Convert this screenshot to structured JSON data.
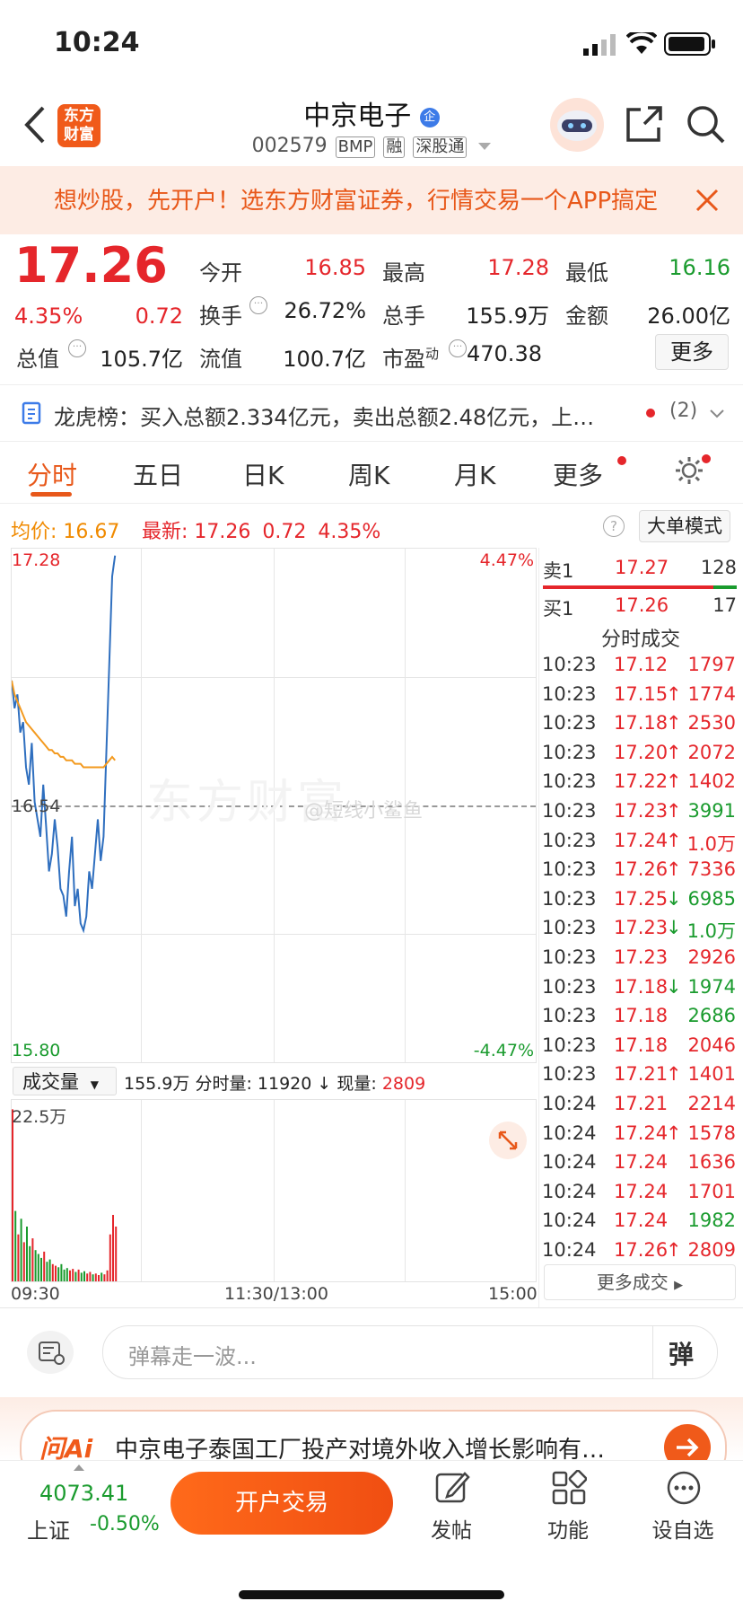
{
  "status_bar": {
    "time": "10:24"
  },
  "header": {
    "stock_name": "中京电子",
    "code": "002579",
    "tags": [
      "BMP",
      "融",
      "深股通"
    ],
    "logo_text_top": "东方",
    "logo_text_bottom": "财富"
  },
  "banner": {
    "text": "想炒股，先开户！选东方财富证券，行情交易一个APP搞定"
  },
  "quote": {
    "price": "17.26",
    "change_pct": "4.35%",
    "change": "0.72",
    "open_label": "今开",
    "open": "16.85",
    "high_label": "最高",
    "high": "17.28",
    "low_label": "最低",
    "low": "16.16",
    "turnover_label": "换手",
    "turnover": "26.72%",
    "volume_label": "总手",
    "volume": "155.9万",
    "amount_label": "金额",
    "amount": "26.00亿",
    "mktcap_label": "总值",
    "mktcap": "105.7亿",
    "float_label": "流值",
    "float": "100.7亿",
    "pe_label": "市盈",
    "pe_sup": "动",
    "pe": "470.38",
    "more_button": "更多"
  },
  "dragon_tiger": {
    "text": "龙虎榜：买入总额2.334亿元，卖出总额2.48亿元，上…",
    "count": "(2)"
  },
  "tabs": [
    "分时",
    "五日",
    "日K",
    "周K",
    "月K",
    "更多"
  ],
  "active_tab": "分时",
  "info_line": {
    "avg_label": "均价:",
    "avg": "16.67",
    "latest_label": "最新:",
    "latest": "17.26",
    "latest_change": "0.72",
    "latest_pct": "4.35%",
    "big_order_button": "大单模式"
  },
  "chart": {
    "y_top": "17.28",
    "y_mid": "16.54",
    "y_bottom": "15.80",
    "pct_top": "4.47%",
    "pct_bottom": "-4.47%",
    "watermark": "东方财富",
    "watermark2": "@短线小鲨鱼",
    "volume_selector": "成交量",
    "volume_summary_total": "155.9万",
    "volume_summary_tick_label": "分时量:",
    "volume_summary_tick": "11920",
    "volume_summary_now_label": "现量:",
    "volume_summary_now": "2809",
    "vol_axis_max": "22.5万",
    "x_start": "09:30",
    "x_mid": "11:30/13:00",
    "x_end": "15:00"
  },
  "chart_data": {
    "type": "line",
    "series": [
      {
        "values": [
          16.9,
          16.82,
          16.86,
          16.75,
          16.78,
          16.65,
          16.6,
          16.72,
          16.55,
          16.5,
          16.45,
          16.6,
          16.48,
          16.35,
          16.4,
          16.5,
          16.42,
          16.3,
          16.28,
          16.22,
          16.35,
          16.45,
          16.25,
          16.3,
          16.2,
          16.18,
          16.22,
          16.35,
          16.3,
          16.4,
          16.5,
          16.38,
          16.45,
          16.7,
          16.95,
          17.2,
          17.26
        ]
      },
      {
        "values": [
          16.9,
          16.86,
          16.84,
          16.82,
          16.8,
          16.78,
          16.77,
          16.76,
          16.75,
          16.74,
          16.73,
          16.72,
          16.71,
          16.7,
          16.7,
          16.69,
          16.69,
          16.68,
          16.68,
          16.67,
          16.67,
          16.67,
          16.66,
          16.66,
          16.66,
          16.65,
          16.65,
          16.65,
          16.65,
          16.65,
          16.65,
          16.65,
          16.65,
          16.66,
          16.67,
          16.68,
          16.67
        ]
      }
    ],
    "ylim": [
      15.8,
      17.28
    ]
  },
  "volume_data": [
    220000,
    90000,
    60000,
    80000,
    50000,
    70000,
    45000,
    55000,
    40000,
    35000,
    30000,
    38000,
    25000,
    28000,
    22000,
    20000,
    18000,
    22000,
    15000,
    17000,
    14000,
    16000,
    12000,
    15000,
    11000,
    13000,
    10000,
    12000,
    9000,
    10000,
    8000,
    11000,
    9000,
    14000,
    60000,
    85000,
    70000
  ],
  "order_book": {
    "ask_label": "卖1",
    "ask_price": "17.27",
    "ask_vol": "128",
    "bid_label": "买1",
    "bid_price": "17.26",
    "bid_vol": "17",
    "trades_title": "分时成交",
    "more_trades": "更多成交"
  },
  "trades": [
    {
      "t": "10:23",
      "p": "17.12",
      "a": "",
      "v": "1797",
      "vc": "red"
    },
    {
      "t": "10:23",
      "p": "17.15",
      "a": "↑",
      "v": "1774",
      "vc": "red"
    },
    {
      "t": "10:23",
      "p": "17.18",
      "a": "↑",
      "v": "2530",
      "vc": "red"
    },
    {
      "t": "10:23",
      "p": "17.20",
      "a": "↑",
      "v": "2072",
      "vc": "red"
    },
    {
      "t": "10:23",
      "p": "17.22",
      "a": "↑",
      "v": "1402",
      "vc": "red"
    },
    {
      "t": "10:23",
      "p": "17.23",
      "a": "↑",
      "v": "3991",
      "vc": "green"
    },
    {
      "t": "10:23",
      "p": "17.24",
      "a": "↑",
      "v": "1.0万",
      "vc": "red"
    },
    {
      "t": "10:23",
      "p": "17.26",
      "a": "↑",
      "v": "7336",
      "vc": "red"
    },
    {
      "t": "10:23",
      "p": "17.25",
      "a": "↓",
      "v": "6985",
      "vc": "green"
    },
    {
      "t": "10:23",
      "p": "17.23",
      "a": "↓",
      "v": "1.0万",
      "vc": "green"
    },
    {
      "t": "10:23",
      "p": "17.23",
      "a": "",
      "v": "2926",
      "vc": "red"
    },
    {
      "t": "10:23",
      "p": "17.18",
      "a": "↓",
      "v": "1974",
      "vc": "green"
    },
    {
      "t": "10:23",
      "p": "17.18",
      "a": "",
      "v": "2686",
      "vc": "green"
    },
    {
      "t": "10:23",
      "p": "17.18",
      "a": "",
      "v": "2046",
      "vc": "red"
    },
    {
      "t": "10:23",
      "p": "17.21",
      "a": "↑",
      "v": "1401",
      "vc": "red"
    },
    {
      "t": "10:24",
      "p": "17.21",
      "a": "",
      "v": "2214",
      "vc": "red"
    },
    {
      "t": "10:24",
      "p": "17.24",
      "a": "↑",
      "v": "1578",
      "vc": "red"
    },
    {
      "t": "10:24",
      "p": "17.24",
      "a": "",
      "v": "1636",
      "vc": "red"
    },
    {
      "t": "10:24",
      "p": "17.24",
      "a": "",
      "v": "1701",
      "vc": "red"
    },
    {
      "t": "10:24",
      "p": "17.24",
      "a": "",
      "v": "1982",
      "vc": "green"
    },
    {
      "t": "10:24",
      "p": "17.26",
      "a": "↑",
      "v": "2809",
      "vc": "red"
    }
  ],
  "comment_bar": {
    "placeholder": "弹幕走一波...",
    "danmu_label": "弹"
  },
  "ai_card": {
    "brand": "问Ai",
    "text": "中京电子泰国工厂投产对境外收入增长影响有…"
  },
  "bottom_bar": {
    "index_value": "4073.41",
    "index_name": "上证",
    "index_change": "-0.50%",
    "trade_button": "开户交易",
    "post_label": "发帖",
    "func_label": "功能",
    "watch_label": "设自选"
  }
}
